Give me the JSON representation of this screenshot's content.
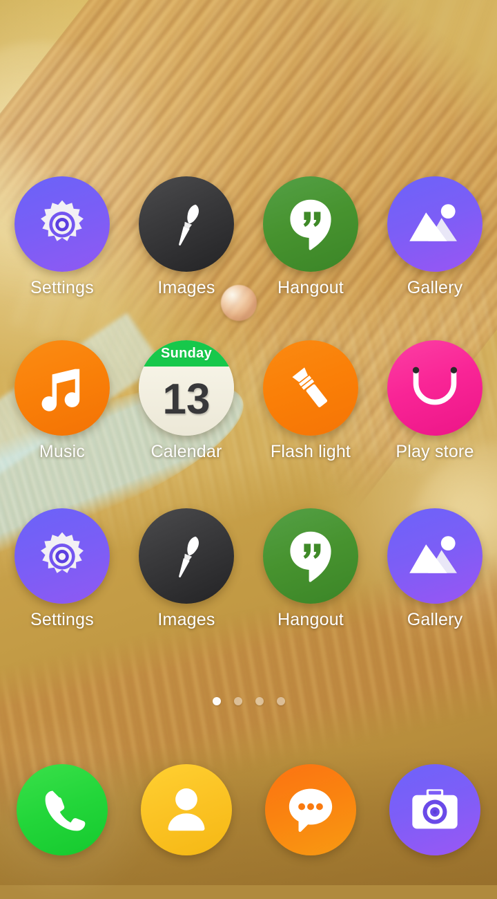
{
  "screen": {
    "name": "android-home-screen",
    "wallpaper_description": "abstract golden brown light streaks",
    "background_color": "#cdad57"
  },
  "home_grid": {
    "rows": [
      {
        "apps": [
          {
            "label": "Settings",
            "icon": "gear-icon",
            "color": "#7a5ef6"
          },
          {
            "label": "Images",
            "icon": "paintbrush-icon",
            "color": "#3a3a3c"
          },
          {
            "label": "Hangout",
            "icon": "chat-quote-icon",
            "color": "#47932f"
          },
          {
            "label": "Gallery",
            "icon": "photo-mountain-icon",
            "color": "#7c5ef6"
          }
        ]
      },
      {
        "apps": [
          {
            "label": "Music",
            "icon": "music-note-icon",
            "color": "#f97f08"
          },
          {
            "label": "Calendar",
            "icon": "calendar-icon",
            "color": "#17c84b",
            "weekday": "Sunday",
            "day_number": "13"
          },
          {
            "label": "Flash light",
            "icon": "flashlight-icon",
            "color": "#fa7f07"
          },
          {
            "label": "Play store",
            "icon": "shopping-bag-icon",
            "color": "#f92596"
          }
        ]
      },
      {
        "apps": [
          {
            "label": "Settings",
            "icon": "gear-icon",
            "color": "#7a5ef6"
          },
          {
            "label": "Images",
            "icon": "paintbrush-icon",
            "color": "#3a3a3c"
          },
          {
            "label": "Hangout",
            "icon": "chat-quote-icon",
            "color": "#47932f"
          },
          {
            "label": "Gallery",
            "icon": "photo-mountain-icon",
            "color": "#7c5ef6"
          }
        ]
      }
    ]
  },
  "page_indicator": {
    "total": 4,
    "active_index": 0
  },
  "dock": {
    "apps": [
      {
        "label": "Phone",
        "icon": "phone-handset-icon",
        "color": "#23d63a"
      },
      {
        "label": "Contacts",
        "icon": "person-icon",
        "color": "#fbc324"
      },
      {
        "label": "Messages",
        "icon": "message-bubble-icon",
        "color": "#fa8310"
      },
      {
        "label": "Camera",
        "icon": "camera-icon",
        "color": "#7e5ef7"
      }
    ]
  }
}
